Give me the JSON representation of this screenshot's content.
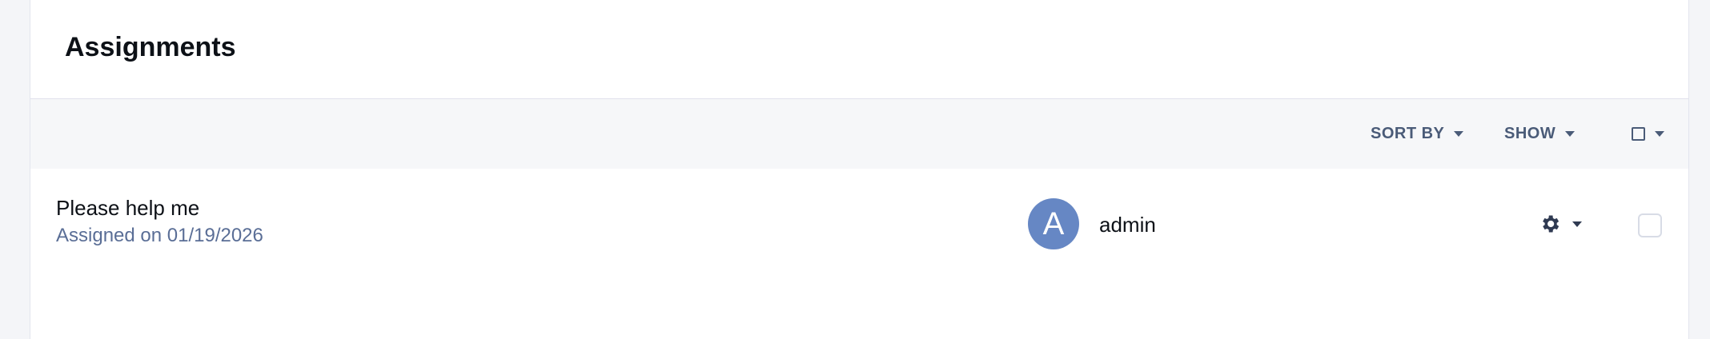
{
  "panel": {
    "title": "Assignments"
  },
  "toolbar": {
    "sort_label": "SORT BY",
    "show_label": "SHOW"
  },
  "assignments": [
    {
      "title": "Please help me",
      "subtitle": "Assigned on 01/19/2026",
      "avatar_initial": "A",
      "user": "admin"
    }
  ],
  "icons": {
    "settings": "gear-icon",
    "dropdown": "chevron-down-icon",
    "select_all": "checkbox-icon"
  },
  "colors": {
    "avatar": "#6687c4",
    "toolbar_text": "#4a5b78",
    "subtitle": "#5a6e96"
  }
}
